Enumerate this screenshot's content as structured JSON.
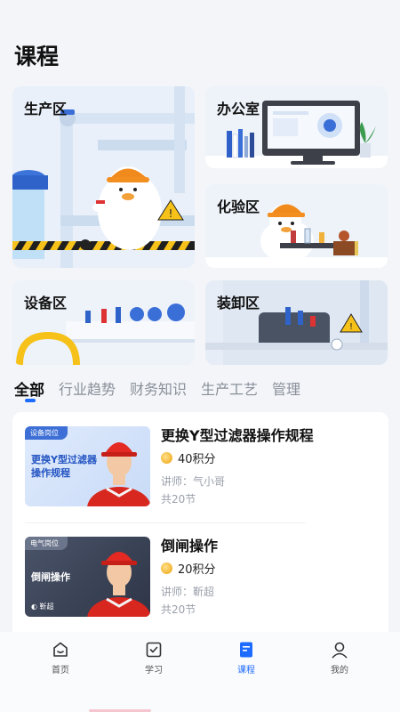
{
  "page": {
    "title": "课程"
  },
  "areas": {
    "production": "生产区",
    "office": "办公室",
    "lab": "化验区",
    "equipment": "设备区",
    "loading": "装卸区"
  },
  "tabs": [
    {
      "label": "全部",
      "active": true
    },
    {
      "label": "行业趋势"
    },
    {
      "label": "财务知识"
    },
    {
      "label": "生产工艺"
    },
    {
      "label": "管理"
    }
  ],
  "courses": [
    {
      "tag": "设备岗位",
      "thumb_title": "更换Y型过滤器操作规程",
      "thumb_author": "",
      "title": "更换Y型过滤器操作规程",
      "points": "40积分",
      "instructor": "讲师：气小哥",
      "lessons": "共20节"
    },
    {
      "tag": "电气岗位",
      "thumb_title": "倒闸操作",
      "thumb_author": "◐ 靳超",
      "title": "倒闸操作",
      "points": "20积分",
      "instructor": "讲师：靳超",
      "lessons": "共20节"
    }
  ],
  "nav": {
    "home": "首页",
    "study": "学习",
    "course": "课程",
    "mine": "我的"
  },
  "colors": {
    "accent": "#1e6bff",
    "coin": "#f3b431",
    "helmet": "#f08a1c"
  }
}
